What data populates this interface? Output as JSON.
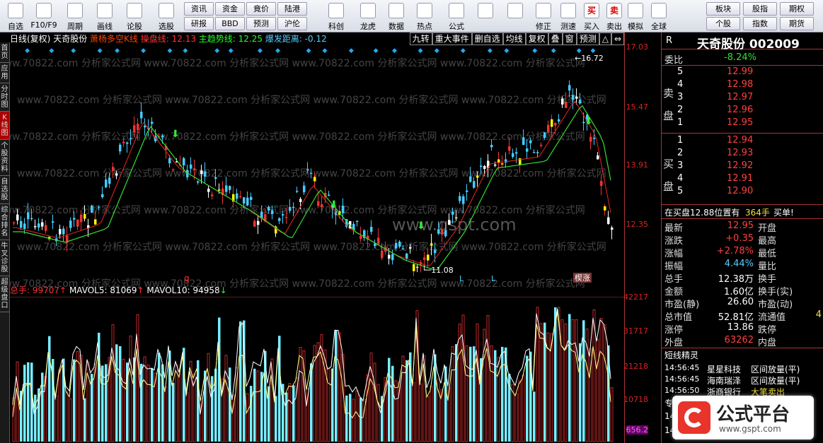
{
  "toolbar": {
    "buttons": [
      {
        "label": "自选",
        "icon": "heart-icon"
      },
      {
        "label": "F10/F9",
        "icon": "f10-icon"
      },
      {
        "label": "周期",
        "icon": "clock-icon"
      },
      {
        "label": "画线",
        "icon": "pen-icon"
      },
      {
        "label": "论股",
        "icon": "discuss-icon"
      },
      {
        "label": "选股",
        "icon": "chart-icon"
      }
    ],
    "grid_buttons": [
      [
        "资讯",
        "资金",
        "竟价",
        "陆港"
      ],
      [
        "研报",
        "BBD",
        "预测",
        "沪伦"
      ]
    ],
    "right_buttons": [
      {
        "label": "科创",
        "icon": "kechuang-icon"
      },
      {
        "label": "龙虎",
        "icon": "dragon-icon"
      },
      {
        "label": "数据",
        "icon": "pe-icon"
      },
      {
        "label": "热点",
        "icon": "hot-icon"
      },
      {
        "label": "公式",
        "icon": "formula-icon"
      }
    ],
    "nav_buttons": [
      {
        "label": "",
        "icon": "layout-icon"
      },
      {
        "label": "",
        "icon": "back-arrow-icon"
      },
      {
        "label": "修正",
        "icon": "fix-icon"
      },
      {
        "label": "测速",
        "icon": "speed-icon"
      },
      {
        "label": "买入",
        "icon": "buy-icon",
        "glyph": "买"
      },
      {
        "label": "卖出",
        "icon": "sell-icon",
        "glyph": "卖"
      },
      {
        "label": "模拟",
        "icon": "simulate-icon"
      },
      {
        "label": "全球",
        "icon": "globe-icon"
      }
    ],
    "grid2": [
      [
        "板块",
        "股指",
        "期权"
      ],
      [
        "个股",
        "指数",
        "期货"
      ]
    ]
  },
  "leftbar": {
    "tabs": [
      "首页",
      "应用",
      "分时图",
      "K线图",
      "个股资料",
      "自选股",
      "综合排名",
      "牛叉诊股",
      "超级盘口"
    ]
  },
  "infobar": {
    "period": "日线(复权)",
    "stock": "天奇股份",
    "ind1": "萧杨多空K线",
    "ind2": "操盘线: 12.13",
    "ind3": "主趋势线: 12.25",
    "ind4": "爆发距离: -0.12",
    "tools": [
      "九转",
      "重大事件",
      "删自选",
      "均线",
      "复权",
      "叠",
      "窗",
      "预测",
      "△",
      "⇔"
    ]
  },
  "axis": {
    "top": [
      "17.03",
      "15.47",
      "13.91",
      "12.35"
    ],
    "bottom": [
      "42217",
      "31717",
      "21218",
      "10718",
      "656.2"
    ]
  },
  "chart_labels": {
    "high": "16.72",
    "low": "11.08",
    "q": "q",
    "l1": "L",
    "l2": "L",
    "zt": "楔涨",
    "watermark": "www.70822.com 分析家公式网",
    "center_wm": "www.gspt.com"
  },
  "volbar": {
    "label": "总手: 99707",
    "mavol5": "MAVOL5: 81069",
    "mavol10": "MAVOL10: 94958"
  },
  "quote": {
    "title": "天奇股份 002009",
    "weibi_label": "委比",
    "weibi": "-8.24%",
    "sell_label": "卖盘",
    "buy_label": "买盘",
    "asks": [
      {
        "n": "5",
        "p": "12.99"
      },
      {
        "n": "4",
        "p": "12.98"
      },
      {
        "n": "3",
        "p": "12.97"
      },
      {
        "n": "2",
        "p": "12.96"
      },
      {
        "n": "1",
        "p": "12.95"
      }
    ],
    "bids": [
      {
        "n": "1",
        "p": "12.94"
      },
      {
        "n": "2",
        "p": "12.93"
      },
      {
        "n": "3",
        "p": "12.92"
      },
      {
        "n": "4",
        "p": "12.91"
      },
      {
        "n": "5",
        "p": "12.90"
      }
    ],
    "notice": "在买盘12.88位置有",
    "notice_qty": "364手",
    "notice_tail": "买单!",
    "stats": [
      [
        "最新",
        "12.95",
        "开盘",
        ""
      ],
      [
        "涨跌",
        "+0.35",
        "最高",
        ""
      ],
      [
        "涨幅",
        "+2.78%",
        "最低",
        ""
      ],
      [
        "振幅",
        "4.44%",
        "量比",
        ""
      ],
      [
        "总手",
        "12.38万",
        "换手",
        ""
      ],
      [
        "金额",
        "1.60亿",
        "换手(实)",
        ""
      ],
      [
        "市盈(静)",
        "26.60",
        "市盈(动)",
        ""
      ],
      [
        "总市值",
        "52.81亿",
        "流通值",
        "4"
      ],
      [
        "涨停",
        "13.86",
        "跌停",
        ""
      ],
      [
        "外盘",
        "63262",
        "内盘",
        ""
      ]
    ],
    "elf_title": "短线精灵",
    "elf": [
      {
        "t": "14:56:45",
        "n": "星星科技",
        "e": "区间放量(平)"
      },
      {
        "t": "14:56:45",
        "n": "海南瑞泽",
        "e": "区间放量(平)"
      },
      {
        "t": "14:56:50",
        "n": "浙商银行",
        "e": "大笔卖出"
      }
    ],
    "tail_rows": [
      {
        "t": "专"
      },
      {
        "t": "14"
      },
      {
        "t": "14"
      }
    ]
  },
  "logo": {
    "text": "公式平台",
    "sub": "www.gspt.com"
  }
}
